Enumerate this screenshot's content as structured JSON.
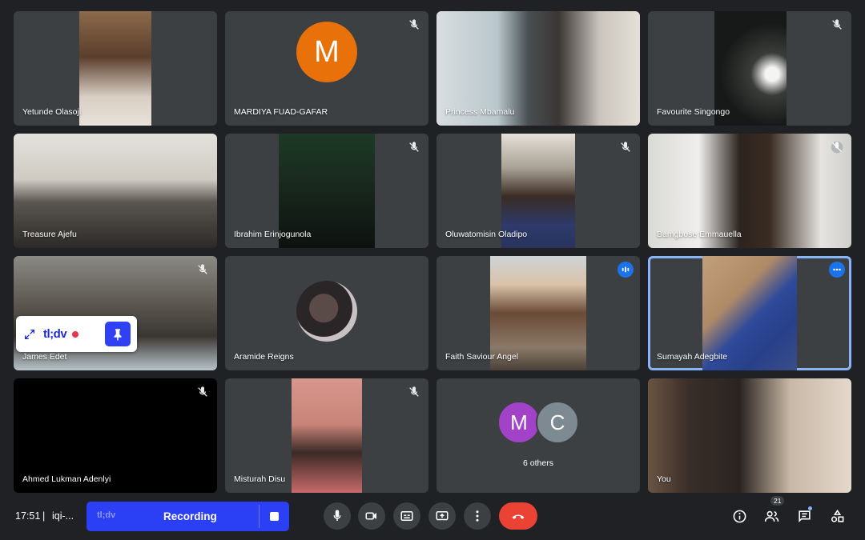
{
  "participants": [
    {
      "name": "Yetunde Olasoji"
    },
    {
      "name": "MARDIYA FUAD-GAFAR",
      "initial": "M",
      "avatar_color": "#e8710a"
    },
    {
      "name": "Princess Mbamalu"
    },
    {
      "name": "Favourite Singongo"
    },
    {
      "name": "Treasure Ajefu"
    },
    {
      "name": "Ibrahim Erinjogunola"
    },
    {
      "name": "Oluwatomisin Oladipo"
    },
    {
      "name": "Bamgbose Emmauella"
    },
    {
      "name": "James Edet"
    },
    {
      "name": "Aramide Reigns"
    },
    {
      "name": "Faith Saviour Angel"
    },
    {
      "name": "Sumayah Adegbite"
    },
    {
      "name": "Ahmed Lukman Adenlyi"
    },
    {
      "name": "Misturah Disu"
    },
    {
      "name": "You"
    }
  ],
  "others_tile": {
    "label": "6 others",
    "avatars": [
      {
        "initial": "M",
        "color": "#a142c9"
      },
      {
        "initial": "C",
        "color": "#7d8a92"
      }
    ]
  },
  "tldv_widget": {
    "logo": "tl;dv"
  },
  "bottom_bar": {
    "time": "17:51",
    "separator": "|",
    "meeting_code": "iqi-...",
    "recording_logo": "tl;dv",
    "recording_label": "Recording",
    "participants_count": "21"
  },
  "colors": {
    "background": "#202124",
    "tile": "#3c4043",
    "end_call": "#ea4335",
    "recording": "#2b3ff4",
    "active_speaker": "#8ab4f8"
  }
}
